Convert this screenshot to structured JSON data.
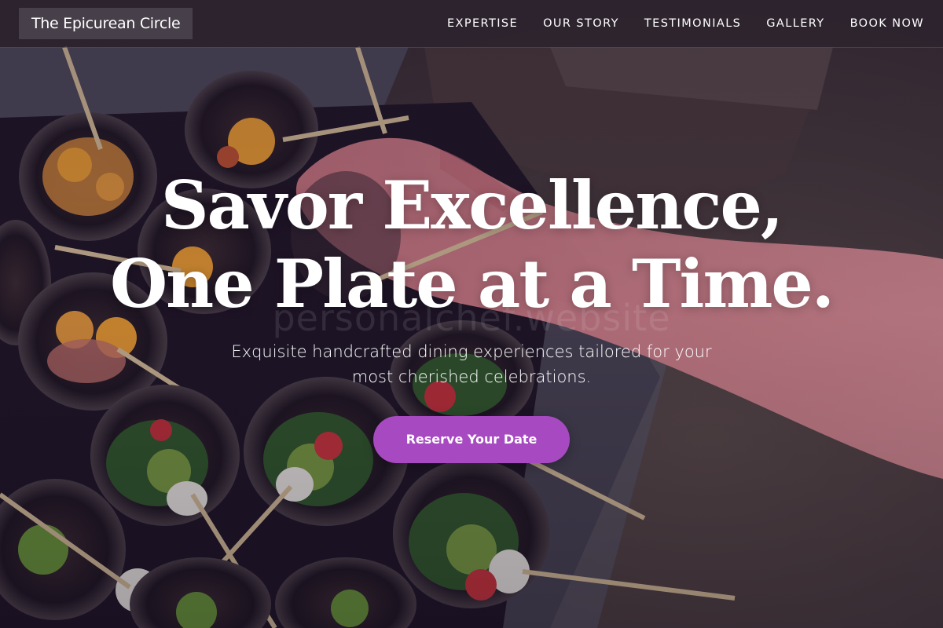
{
  "brand": {
    "name": "The Epicurean Circle"
  },
  "nav": {
    "items": [
      {
        "label": "EXPERTISE"
      },
      {
        "label": "OUR STORY"
      },
      {
        "label": "TESTIMONIALS"
      },
      {
        "label": "GALLERY"
      },
      {
        "label": "BOOK NOW"
      }
    ]
  },
  "hero": {
    "headline_line1": "Savor Excellence,",
    "headline_line2": "One Plate at a Time.",
    "subtitle": "Exquisite handcrafted dining experiences tailored for your most cherished celebrations.",
    "cta_label": "Reserve Your Date",
    "watermark": "personalchef.website"
  },
  "colors": {
    "accent": "#a74ac2",
    "text": "#ffffff",
    "overlay": "#1e1228"
  },
  "icons": {
    "background": "food-photo"
  }
}
